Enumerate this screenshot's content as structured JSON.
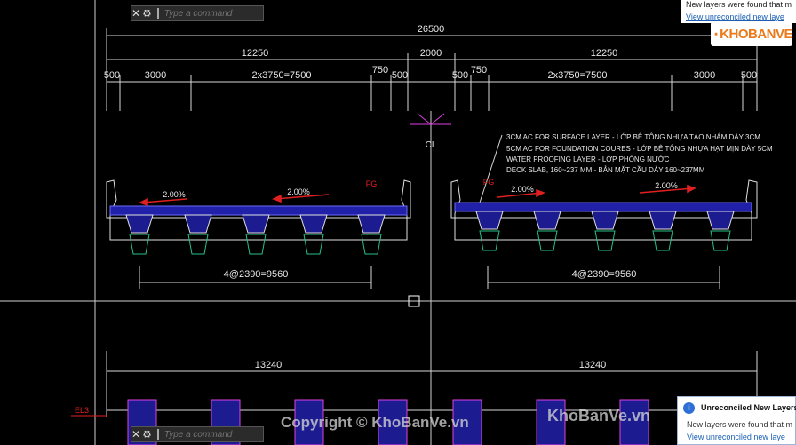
{
  "command_line": {
    "placeholder": "Type a command",
    "close_icon": "close-icon",
    "settings_icon": "wrench-icon"
  },
  "notification_top": {
    "line1": "New layers were found that m",
    "line2": "View unreconciled new laye"
  },
  "notification_bottom": {
    "title": "Unreconciled New Layers",
    "line1": "New layers were found that m",
    "line2": "View unreconciled new laye"
  },
  "logo": {
    "text": "KHOBANVE"
  },
  "watermarks": {
    "copyright": "Copyright © KhoBanVe.vn",
    "site": "KhoBanVe.vn"
  },
  "drawing": {
    "total_width": "26500",
    "half_left": "12250",
    "median": "2000",
    "half_right": "12250",
    "dim_500_a": "500",
    "dim_3000_a": "3000",
    "lanes_left": "2x3750=7500",
    "dim_750_a": "750",
    "dim_500_b": "500",
    "dim_500_c": "500",
    "dim_750_b": "750",
    "lanes_right": "2x3750=7500",
    "dim_3000_b": "3000",
    "dim_500_d": "500",
    "centerline": "CL",
    "notes": [
      "3CM AC FOR SURFACE LAYER - LỚP BÊ TÔNG NHỰA TẠO NHÁM DÀY 3CM",
      "5CM AC FOR FOUNDATION COURES - LỚP BÊ TÔNG NHỰA HẠT MỊN DÀY 5CM",
      "WATER PROOFING LAYER - LỚP PHÒNG NƯỚC",
      "DECK SLAB, 160~237 MM - BẢN MẶT CẦU DÀY 160~237MM"
    ],
    "slope_1": "2.00%",
    "slope_2": "2.00%",
    "slope_3": "2.00%",
    "slope_4": "2.00%",
    "fg_left": "FG",
    "fg_right": "FG",
    "girders_left": "4@2390=9560",
    "girders_right": "4@2390=9560",
    "pier_left": "13240",
    "pier_right": "13240",
    "elevation": "EL3"
  },
  "colors": {
    "background": "#000000",
    "dim_lines": "#d8d8d8",
    "slab_fill": "#2020a8",
    "girder_outline": "#e0e0e0",
    "bearing": "#26c08a",
    "slope_arrow": "#e02020",
    "centerline_mark": "#e040e0"
  }
}
